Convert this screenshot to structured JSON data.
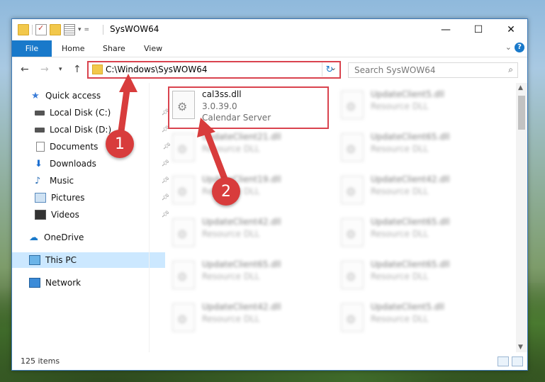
{
  "window": {
    "title": "SysWOW64",
    "controls": {
      "minimize": "—",
      "maximize": "☐",
      "close": "✕"
    }
  },
  "ribbon": {
    "tabs": [
      "File",
      "Home",
      "Share",
      "View"
    ],
    "help": "?"
  },
  "address": {
    "path": "C:\\Windows\\SysWOW64",
    "search_placeholder": "Search SysWOW64"
  },
  "nav": {
    "quick_access": "Quick access",
    "items": [
      "Local Disk (C:)",
      "Local Disk (D:)",
      "Documents",
      "Downloads",
      "Music",
      "Pictures",
      "Videos"
    ],
    "onedrive": "OneDrive",
    "this_pc": "This PC",
    "network": "Network"
  },
  "files": [
    {
      "name": "cal3ss.dll",
      "version": "3.0.39.0",
      "description": "Calendar Server"
    },
    {
      "name": "UpdateClient5.dll",
      "version": "Resource DLL"
    },
    {
      "name": "UpdateClient21.dll",
      "version": "Resource DLL"
    },
    {
      "name": "UpdateClient65.dll",
      "version": "Resource DLL"
    },
    {
      "name": "UpdateClient19.dll",
      "version": "Resource DLL"
    },
    {
      "name": "UpdateClient42.dll",
      "version": "Resource DLL"
    },
    {
      "name": "UpdateClient42.dll",
      "version": "Resource DLL"
    },
    {
      "name": "UpdateClient65.dll",
      "version": "Resource DLL"
    },
    {
      "name": "UpdateClient65.dll",
      "version": "Resource DLL"
    },
    {
      "name": "UpdateClient65.dll",
      "version": "Resource DLL"
    },
    {
      "name": "UpdateClient42.dll",
      "version": "Resource DLL"
    },
    {
      "name": "UpdateClient5.dll",
      "version": "Resource DLL"
    }
  ],
  "status": {
    "count": "125 items"
  },
  "annotations": {
    "badge1": "1",
    "badge2": "2",
    "color": "#d83c3c"
  }
}
